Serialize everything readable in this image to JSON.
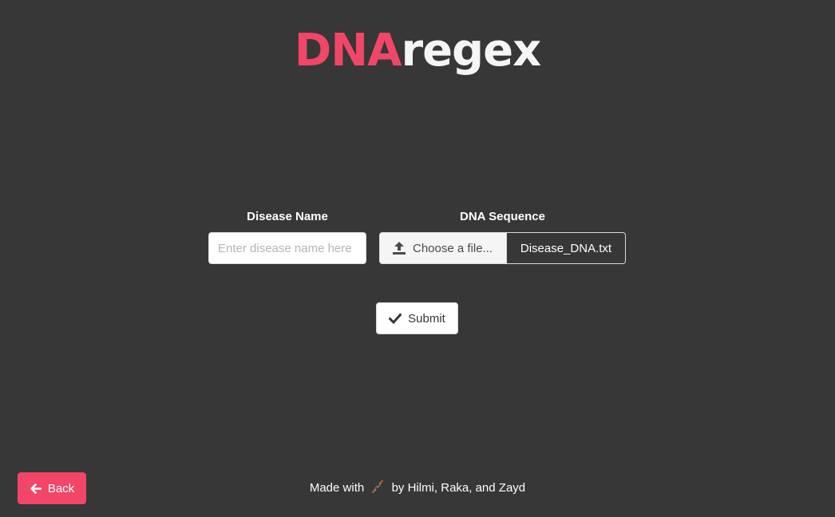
{
  "header": {
    "logo_accent": "DNA",
    "logo_rest": "regex",
    "accent_color": "#f14668"
  },
  "form": {
    "disease_label": "Disease Name",
    "disease_placeholder": "Enter disease name here",
    "disease_value": "",
    "dna_label": "DNA Sequence",
    "choose_file_label": "Choose a file...",
    "file_name": "Disease_DNA.txt",
    "submit_label": "Submit"
  },
  "nav": {
    "back_label": "Back"
  },
  "footer": {
    "made_with": "Made with",
    "credits": "by Hilmi, Raka, and Zayd",
    "icon": "dna-icon"
  },
  "icons": {
    "upload": "upload-icon",
    "submit": "check-icon",
    "back": "arrow-left-icon"
  }
}
